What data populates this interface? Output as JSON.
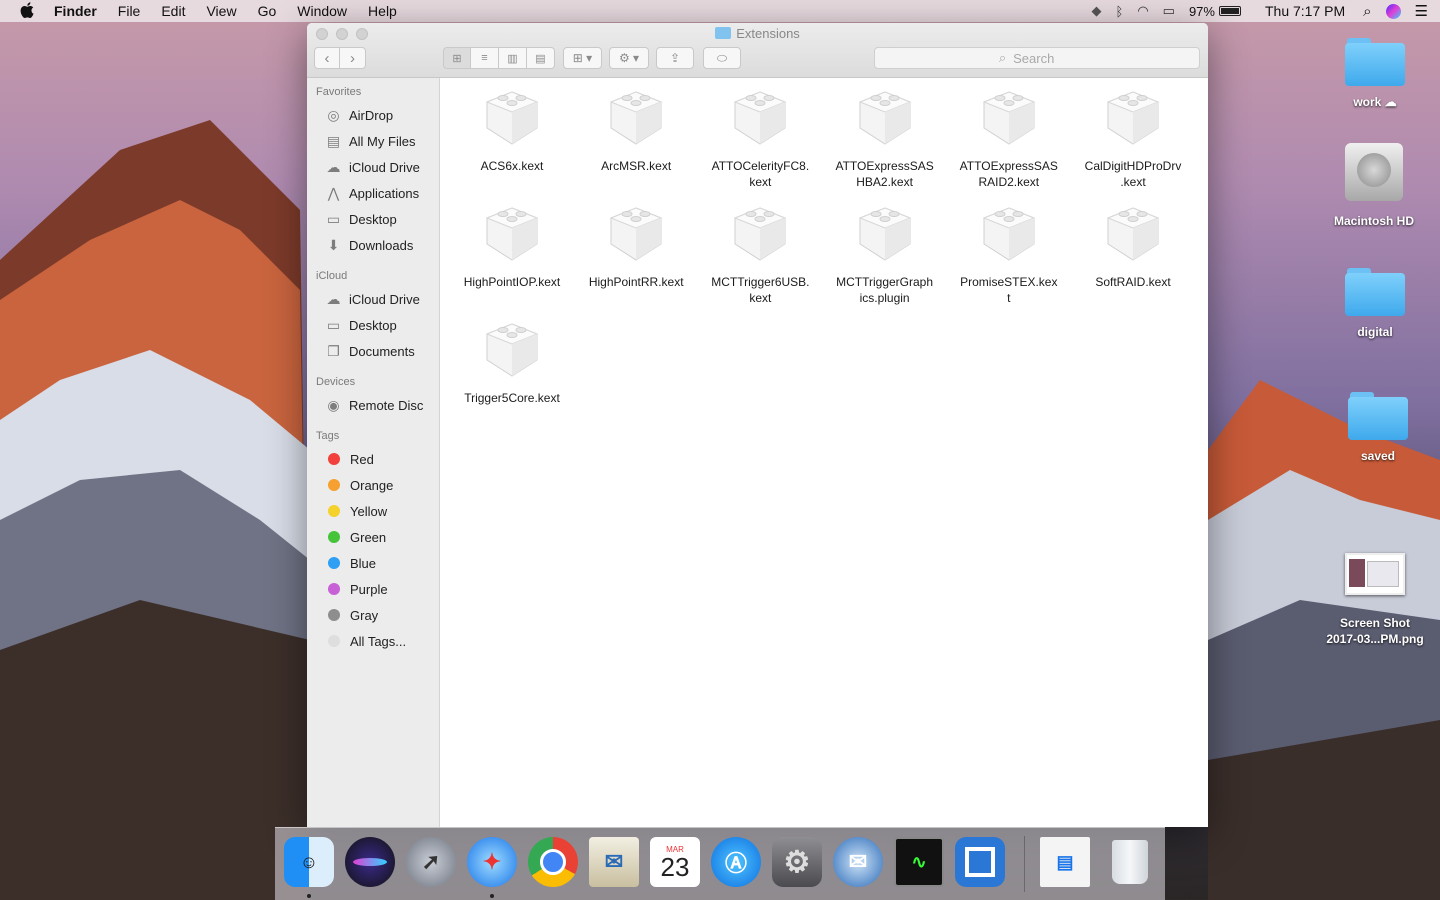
{
  "menubar": {
    "app_name": "Finder",
    "items": [
      "File",
      "Edit",
      "View",
      "Go",
      "Window",
      "Help"
    ],
    "battery": "97%",
    "clock": "Thu 7:17 PM"
  },
  "window": {
    "title": "Extensions",
    "search_placeholder": "Search"
  },
  "sidebar": {
    "favorites_header": "Favorites",
    "favorites": [
      "AirDrop",
      "All My Files",
      "iCloud Drive",
      "Applications",
      "Desktop",
      "Downloads"
    ],
    "icloud_header": "iCloud",
    "icloud": [
      "iCloud Drive",
      "Desktop",
      "Documents"
    ],
    "devices_header": "Devices",
    "devices": [
      "Remote Disc"
    ],
    "tags_header": "Tags",
    "tags": [
      {
        "label": "Red",
        "color": "#f2403c"
      },
      {
        "label": "Orange",
        "color": "#f5a030"
      },
      {
        "label": "Yellow",
        "color": "#f5d12c"
      },
      {
        "label": "Green",
        "color": "#45c43a"
      },
      {
        "label": "Blue",
        "color": "#2e9ff2"
      },
      {
        "label": "Purple",
        "color": "#c860d6"
      },
      {
        "label": "Gray",
        "color": "#8e8e8e"
      },
      {
        "label": "All Tags...",
        "color": "#dedede"
      }
    ]
  },
  "files": [
    {
      "line1": "ACS6x.kext",
      "line2": ""
    },
    {
      "line1": "ArcMSR.kext",
      "line2": ""
    },
    {
      "line1": "ATTOCelerityFC8.",
      "line2": "kext"
    },
    {
      "line1": "ATTOExpressSAS",
      "line2": "HBA2.kext"
    },
    {
      "line1": "ATTOExpressSAS",
      "line2": "RAID2.kext"
    },
    {
      "line1": "CalDigitHDProDrv",
      "line2": ".kext"
    },
    {
      "line1": "HighPointIOP.kext",
      "line2": ""
    },
    {
      "line1": "HighPointRR.kext",
      "line2": ""
    },
    {
      "line1": "MCTTrigger6USB.",
      "line2": "kext"
    },
    {
      "line1": "MCTTriggerGraph",
      "line2": "ics.plugin"
    },
    {
      "line1": "PromiseSTEX.kex",
      "line2": "t"
    },
    {
      "line1": "SoftRAID.kext",
      "line2": ""
    },
    {
      "line1": "Trigger5Core.kext",
      "line2": ""
    }
  ],
  "desktop": {
    "work": "work",
    "macintosh_hd": "Macintosh HD",
    "digital": "digital",
    "saved": "saved",
    "screenshot_line1": "Screen Shot",
    "screenshot_line2": "2017-03...PM.png"
  },
  "dock": {
    "calendar_month": "MAR",
    "calendar_day": "23"
  }
}
